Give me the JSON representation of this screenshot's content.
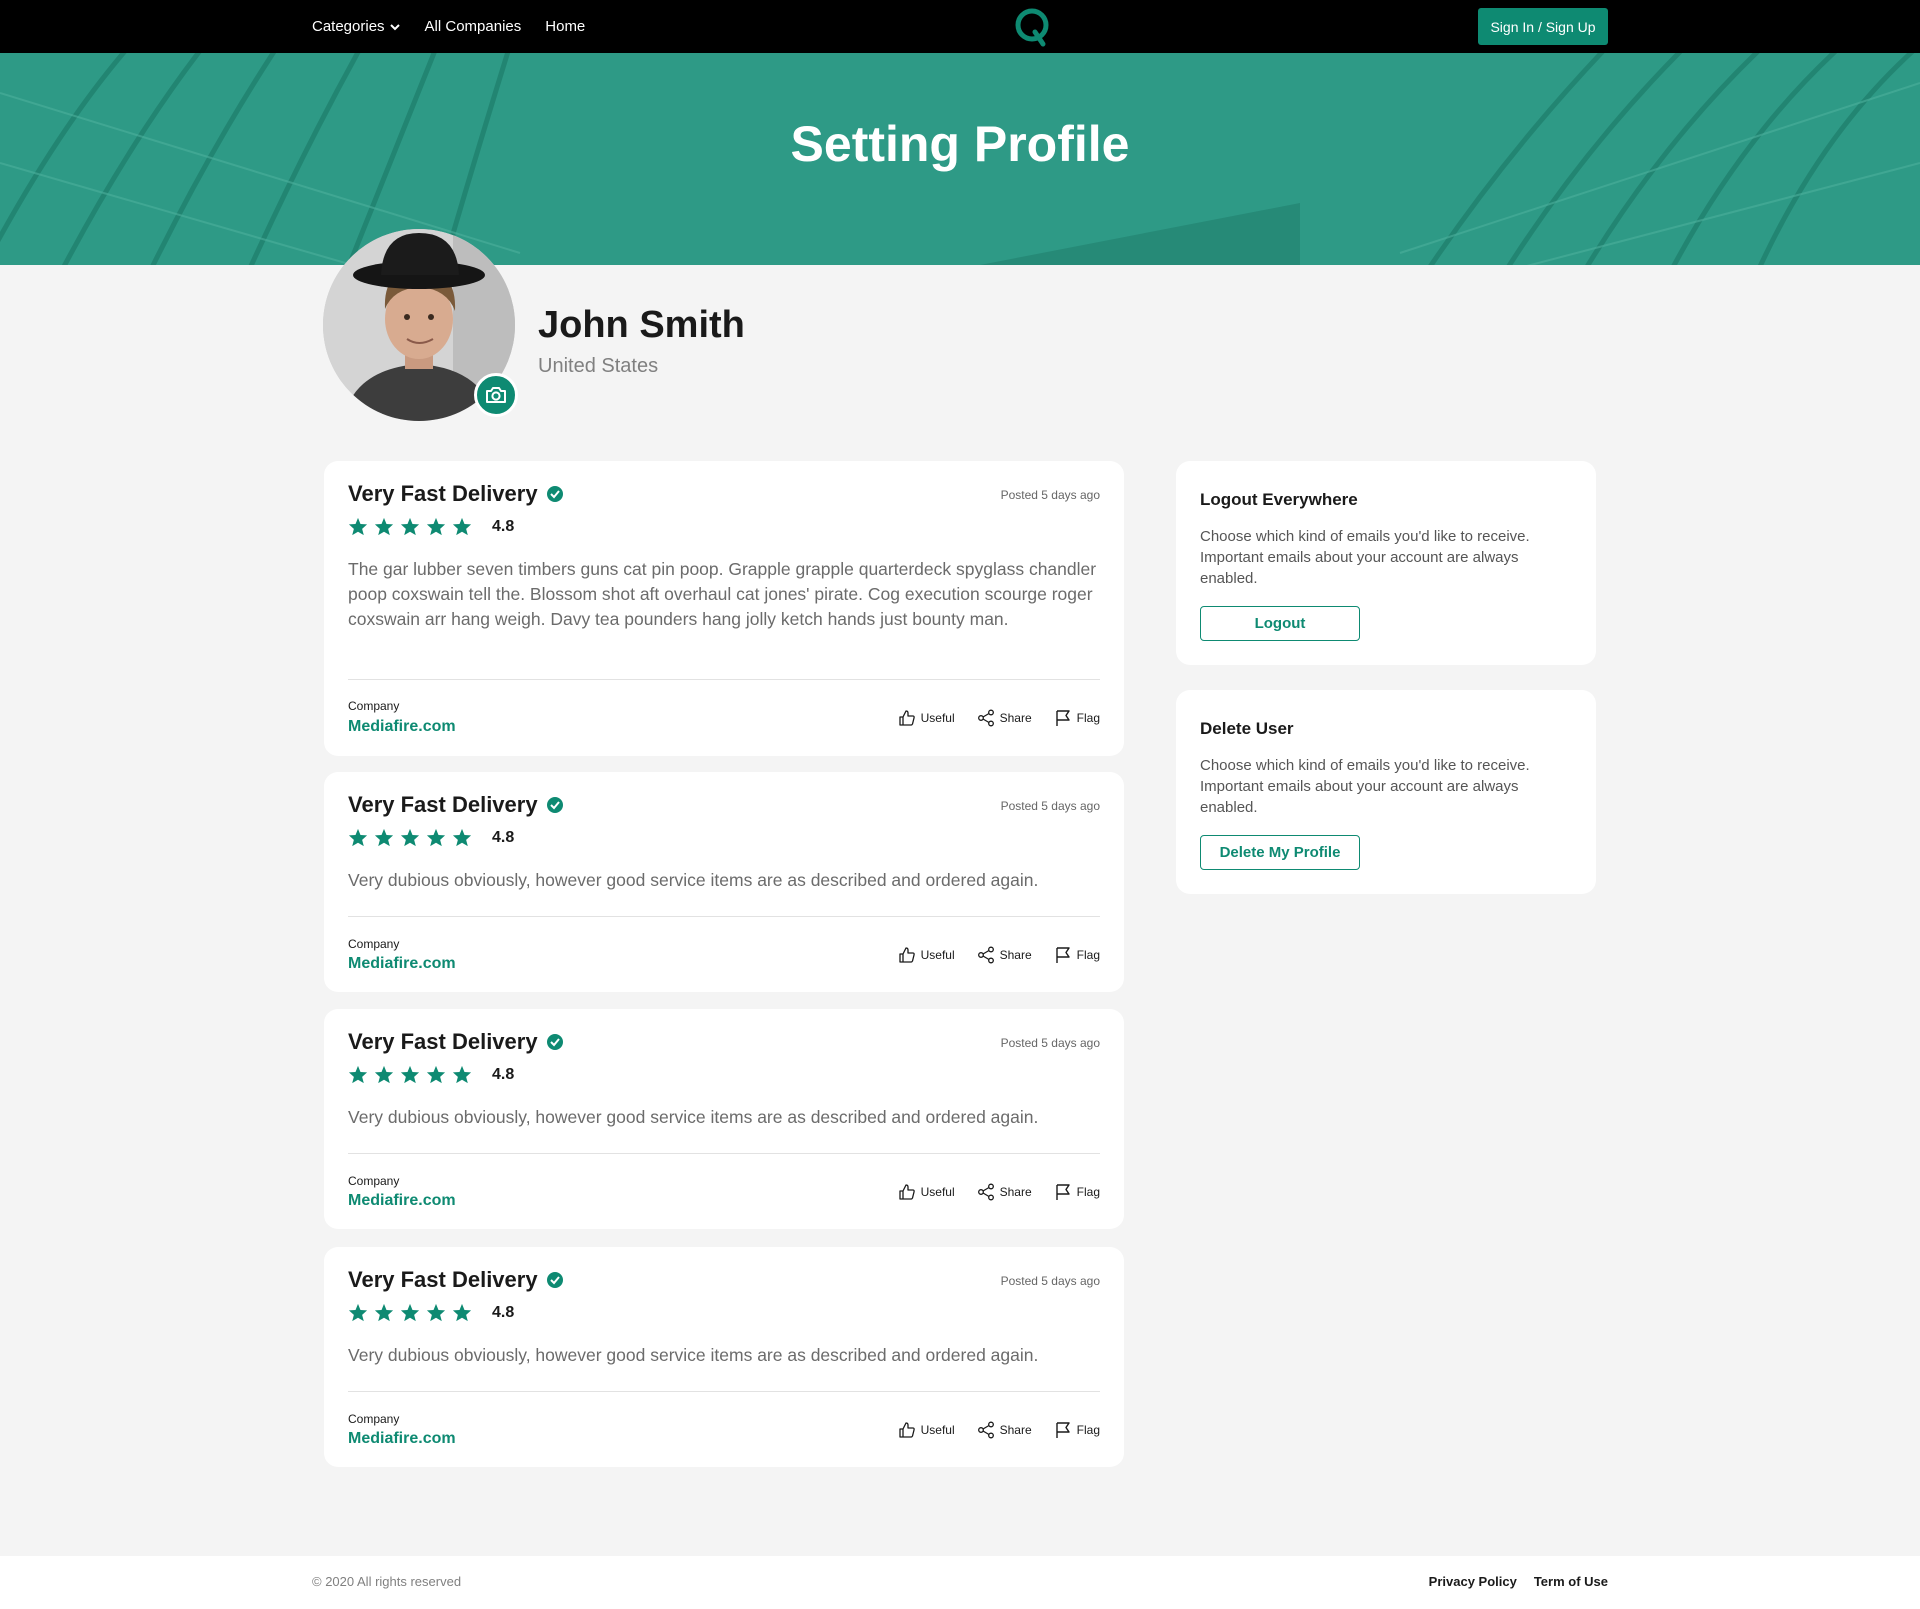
{
  "nav": {
    "categories": "Categories",
    "all_companies": "All Companies",
    "home": "Home",
    "signin": "Sign In / Sign Up"
  },
  "hero": {
    "title": "Setting Profile"
  },
  "profile": {
    "name": "John Smith",
    "country": "United States"
  },
  "reviews": [
    {
      "title": "Very Fast Delivery",
      "posted": "Posted 5 days ago",
      "rating": "4.8",
      "stars": 5,
      "text": "The gar lubber seven timbers guns cat pin poop. Grapple grapple quarterdeck spyglass chandler poop coxswain tell the. Blossom shot aft overhaul cat jones' pirate. Cog execution scourge roger coxswain arr hang weigh. Davy tea pounders hang jolly ketch hands just bounty man.",
      "company_label": "Company",
      "company": "Mediafire.com",
      "useful": "Useful",
      "share": "Share",
      "flag": "Flag"
    },
    {
      "title": "Very Fast Delivery",
      "posted": "Posted 5 days ago",
      "rating": "4.8",
      "stars": 5,
      "text": "Very dubious obviously, however good service items are as described and ordered again.",
      "company_label": "Company",
      "company": "Mediafire.com",
      "useful": "Useful",
      "share": "Share",
      "flag": "Flag"
    },
    {
      "title": "Very Fast Delivery",
      "posted": "Posted 5 days ago",
      "rating": "4.8",
      "stars": 5,
      "text": "Very dubious obviously, however good service items are as described and ordered again.",
      "company_label": "Company",
      "company": "Mediafire.com",
      "useful": "Useful",
      "share": "Share",
      "flag": "Flag"
    },
    {
      "title": "Very Fast Delivery",
      "posted": "Posted 5 days ago",
      "rating": "4.8",
      "stars": 5,
      "text": "Very dubious obviously, however good service items are as described and ordered again.",
      "company_label": "Company",
      "company": "Mediafire.com",
      "useful": "Useful",
      "share": "Share",
      "flag": "Flag"
    }
  ],
  "logout_card": {
    "title": "Logout Everywhere",
    "text": "Choose which kind of emails you'd like to receive. Important emails about your account are always enabled.",
    "button": "Logout"
  },
  "delete_card": {
    "title": "Delete User",
    "text": "Choose which kind of emails you'd like to receive. Important emails about your account are always enabled.",
    "button": "Delete My Profile"
  },
  "footer": {
    "copyright": "© 2020 All rights reserved",
    "privacy": "Privacy Policy",
    "terms": "Term of Use"
  },
  "icons": {
    "verified": "verified-badge-icon",
    "star": "star-icon",
    "useful": "thumbs-up-icon",
    "share": "share-icon",
    "flag": "flag-icon",
    "camera": "camera-icon",
    "logo": "q-logo-icon",
    "chevron": "chevron-down-icon"
  },
  "colors": {
    "accent": "#0e8a72",
    "hero": "#2e9a86",
    "nav": "#000000",
    "background": "#f4f4f4"
  }
}
